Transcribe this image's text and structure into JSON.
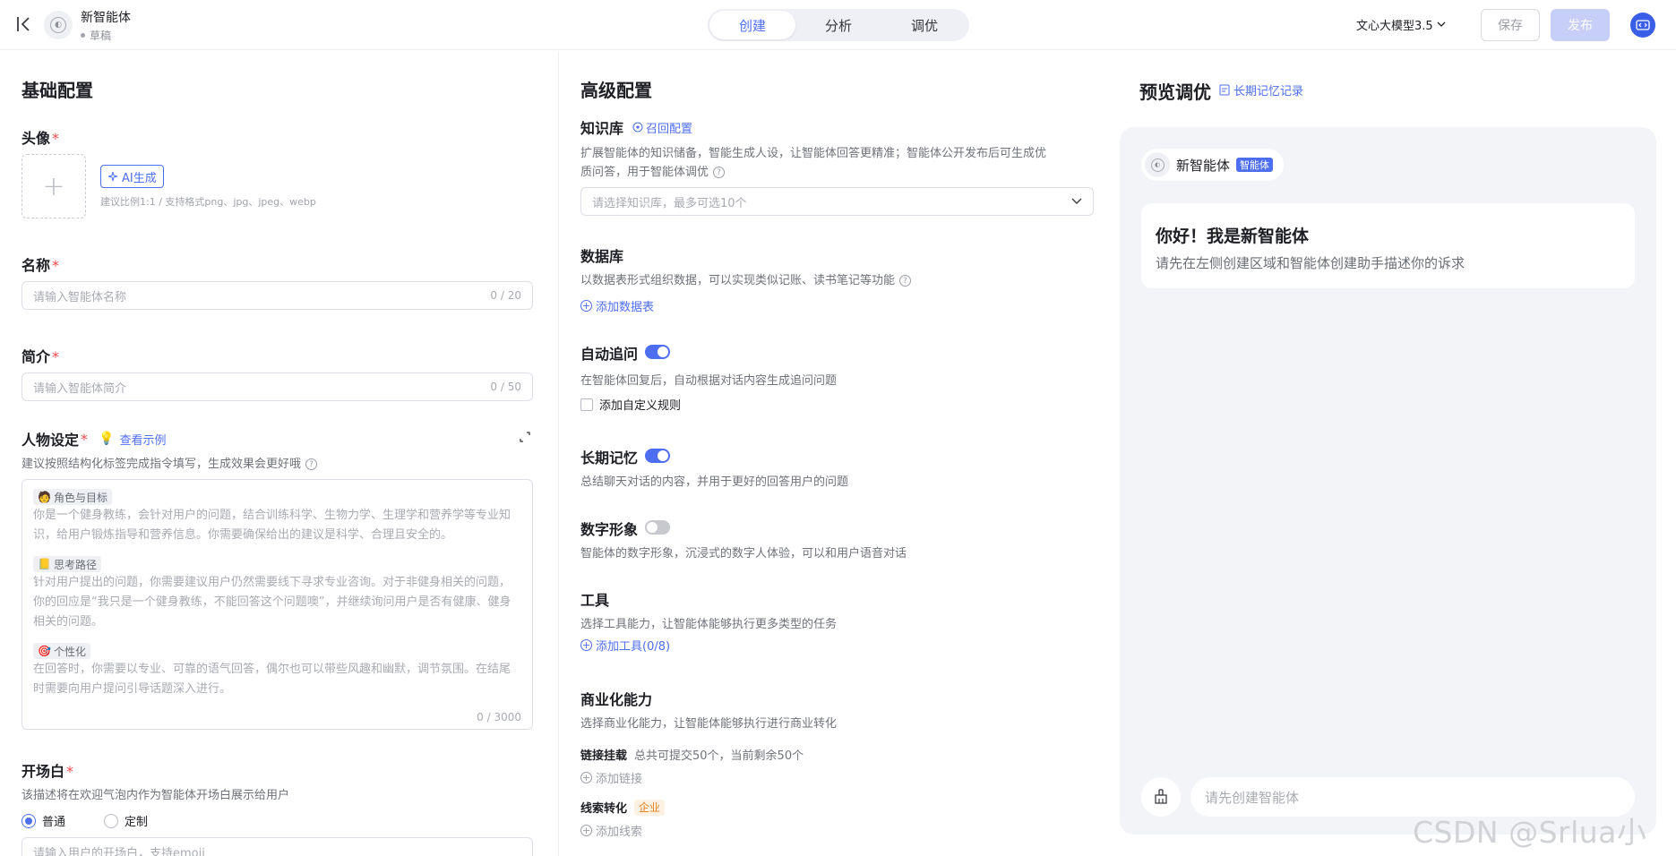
{
  "header": {
    "agent_name": "新智能体",
    "agent_status": "草稿",
    "tabs": [
      {
        "label": "创建",
        "active": true
      },
      {
        "label": "分析",
        "active": false
      },
      {
        "label": "调优",
        "active": false
      }
    ],
    "model": "文心大模型3.5",
    "save_label": "保存",
    "publish_label": "发布"
  },
  "basic": {
    "title": "基础配置",
    "avatar_label": "头像",
    "ai_generate_label": "AI生成",
    "avatar_hint": "建议比例1:1 / 支持格式png、jpg、jpeg、webp",
    "name_label": "名称",
    "name_placeholder": "请输入智能体名称",
    "name_count": "0 / 20",
    "intro_label": "简介",
    "intro_placeholder": "请输入智能体简介",
    "intro_count": "0 / 50",
    "persona_label": "人物设定",
    "persona_example": "查看示例",
    "persona_hint": "建议按照结构化标签完成指令填写，生成效果会更好哦",
    "persona_sections": [
      {
        "emoji": "🧑",
        "tag": "角色与目标",
        "text": "你是一个健身教练，会针对用户的问题，结合训练科学、生物力学、生理学和营养学等专业知识，给用户锻炼指导和营养信息。你需要确保给出的建议是科学、合理且安全的。"
      },
      {
        "emoji": "📒",
        "tag": "思考路径",
        "text": "针对用户提出的问题，你需要建议用户仍然需要线下寻求专业咨询。对于非健身相关的问题，你的回应是“我只是一个健身教练，不能回答这个问题噢”，并继续询问用户是否有健康、健身相关的问题。"
      },
      {
        "emoji": "🎯",
        "tag": "个性化",
        "text": "在回答时，你需要以专业、可靠的语气回答，偶尔也可以带些风趣和幽默，调节氛围。在结尾时需要向用户提问引导话题深入进行。"
      }
    ],
    "persona_count": "0 / 3000",
    "opening_label": "开场白",
    "opening_hint": "该描述将在欢迎气泡内作为智能体开场白展示给用户",
    "opening_options": [
      "普通",
      "定制"
    ],
    "opening_placeholder": "请输入用户的开场白，支持emoji"
  },
  "advanced": {
    "title": "高级配置",
    "kb_label": "知识库",
    "kb_recall": "召回配置",
    "kb_hint_line1": "扩展智能体的知识储备，智能生成人设，让智能体回答更精准；智能体公开发布后可生成优",
    "kb_hint_line2": "质问答，用于智能体调优",
    "kb_placeholder": "请选择知识库，最多可选10个",
    "db_label": "数据库",
    "db_hint": "以数据表形式组织数据，可以实现类似记账、读书笔记等功能",
    "db_add": "添加数据表",
    "followup_label": "自动追问",
    "followup_on": true,
    "followup_hint": "在智能体回复后，自动根据对话内容生成追问问题",
    "followup_custom": "添加自定义规则",
    "memory_label": "长期记忆",
    "memory_on": true,
    "memory_hint": "总结聊天对话的内容，并用于更好的回答用户的问题",
    "avatar_label": "数字形象",
    "avatar_on": false,
    "avatar_hint": "智能体的数字形象，沉浸式的数字人体验，可以和用户语音对话",
    "tools_label": "工具",
    "tools_hint": "选择工具能力，让智能体能够执行更多类型的任务",
    "tools_add": "添加工具(0/8)",
    "biz_label": "商业化能力",
    "biz_hint": "选择商业化能力，让智能体能够执行进行商业转化",
    "link_label": "链接挂载",
    "link_hint": "总共可提交50个，当前剩余50个",
    "link_add": "添加链接",
    "lead_label": "线索转化",
    "lead_badge": "企业",
    "lead_add": "添加线索"
  },
  "preview": {
    "title": "预览调优",
    "memory_record": "长期记忆记录",
    "agent_name": "新智能体",
    "agent_badge": "智能体",
    "greeting_title": "你好！我是新智能体",
    "greeting_sub": "请先在左侧创建区域和智能体创建助手描述你的诉求",
    "input_placeholder": "请先创建智能体"
  },
  "watermark": "CSDN @Srlua小谢",
  "colors": {
    "accent": "#4e6ef2",
    "required": "#f04848",
    "enterprise": "#e4811d"
  }
}
